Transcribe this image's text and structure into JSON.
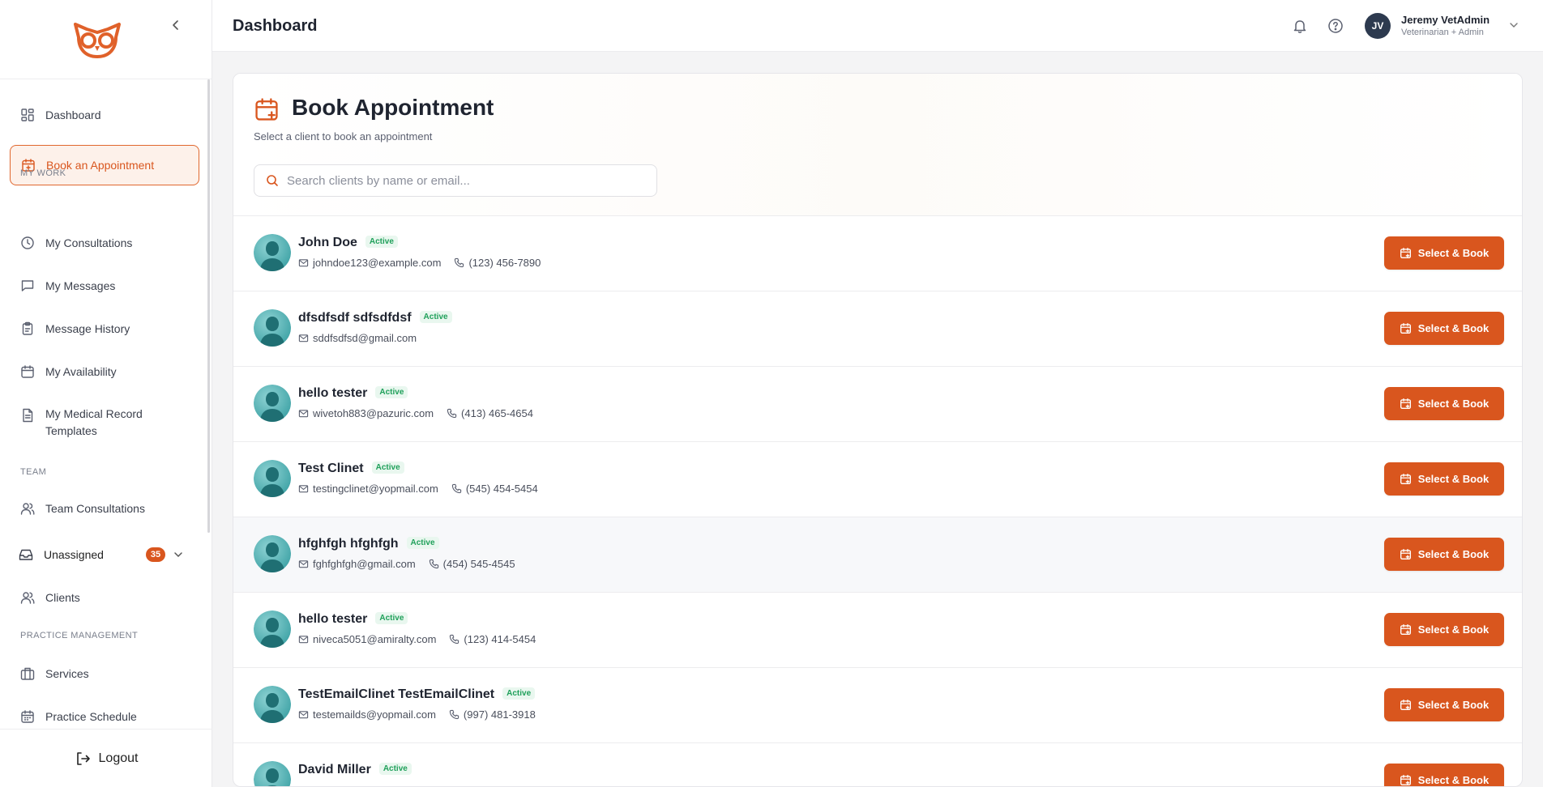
{
  "colors": {
    "accent": "#d9561e",
    "active_bg": "#fdf1ea",
    "status_green": "#1fa05a",
    "avatar_teal": "#2a9ca0"
  },
  "header": {
    "title": "Dashboard",
    "user": {
      "initials": "JV",
      "name": "Jeremy VetAdmin",
      "role": "Veterinarian + Admin"
    }
  },
  "sidebar": {
    "items": [
      {
        "label": "Dashboard",
        "icon": "layout-grid-icon"
      },
      {
        "label": "Book an Appointment",
        "icon": "calendar-plus-icon",
        "active": true
      },
      {
        "label": "My Consultations",
        "icon": "clock-icon"
      },
      {
        "label": "My Messages",
        "icon": "message-square-icon"
      },
      {
        "label": "Message History",
        "icon": "clipboard-icon"
      },
      {
        "label": "My Availability",
        "icon": "calendar-icon"
      },
      {
        "label": "My Medical Record Templates",
        "icon": "file-text-icon"
      },
      {
        "label": "Team Consultations",
        "icon": "users-icon"
      },
      {
        "label": "Unassigned",
        "icon": "inbox-icon",
        "count": "35"
      },
      {
        "label": "Clients",
        "icon": "users-icon"
      },
      {
        "label": "Services",
        "icon": "briefcase-icon"
      },
      {
        "label": "Practice Schedule",
        "icon": "calendar-days-icon"
      }
    ],
    "sections": {
      "my_work": "MY WORK",
      "team": "TEAM",
      "practice": "PRACTICE MANAGEMENT"
    },
    "logout": "Logout"
  },
  "main": {
    "title": "Book Appointment",
    "subtitle": "Select a client to book an appointment",
    "search_placeholder": "Search clients by name or email...",
    "button_label": "Select & Book",
    "clients": [
      {
        "name": "John Doe",
        "status": "Active",
        "email": "johndoe123@example.com",
        "phone": "(123) 456-7890"
      },
      {
        "name": "dfsdfsdf sdfsdfdsf",
        "status": "Active",
        "email": "sddfsdfsd@gmail.com",
        "phone": ""
      },
      {
        "name": "hello tester",
        "status": "Active",
        "email": "wivetoh883@pazuric.com",
        "phone": "(413) 465-4654"
      },
      {
        "name": "Test Clinet",
        "status": "Active",
        "email": "testingclinet@yopmail.com",
        "phone": "(545) 454-5454"
      },
      {
        "name": "hfghfgh hfghfgh",
        "status": "Active",
        "email": "fghfghfgh@gmail.com",
        "phone": "(454) 545-4545"
      },
      {
        "name": "hello tester",
        "status": "Active",
        "email": "niveca5051@amiralty.com",
        "phone": "(123) 414-5454"
      },
      {
        "name": "TestEmailClinet TestEmailClinet",
        "status": "Active",
        "email": "testemailds@yopmail.com",
        "phone": "(997) 481-3918"
      },
      {
        "name": "David Miller",
        "status": "Active",
        "email": "",
        "phone": ""
      }
    ]
  }
}
